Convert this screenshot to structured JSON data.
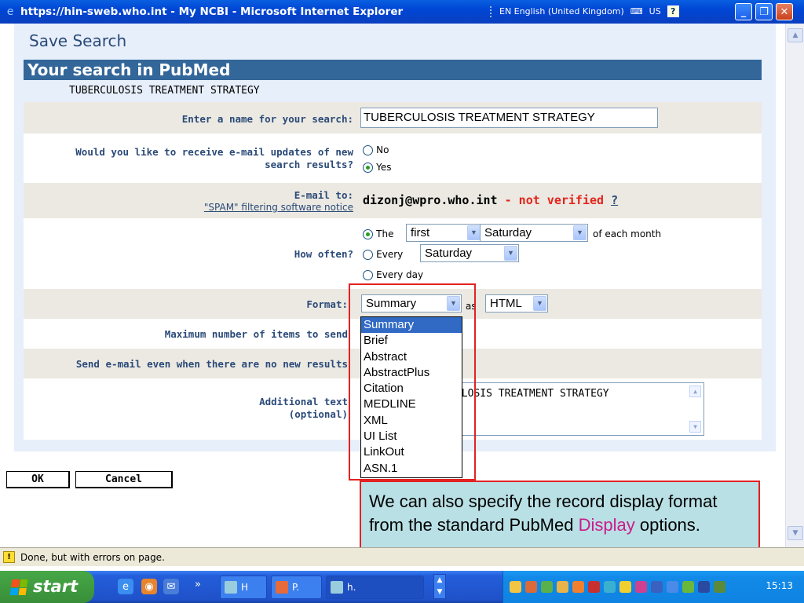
{
  "window": {
    "title": "https://hin-sweb.who.int - My NCBI - Microsoft Internet Explorer",
    "language": "EN English (United Kingdom)",
    "keyboard": "US"
  },
  "page": {
    "heading": "Save Search",
    "section_title": "Your search in PubMed",
    "query": "TUBERCULOSIS TREATMENT STRATEGY",
    "name_label": "Enter a name for your search:",
    "name_value": "TUBERCULOSIS TREATMENT STRATEGY",
    "updates_label_1": "Would you like to receive e-mail updates of new",
    "updates_label_2": "search results?",
    "updates_no": "No",
    "updates_yes": "Yes",
    "email_label": "E-mail to:",
    "spam_link": "\"SPAM\" filtering software notice",
    "email_value": "dizonj@wpro.who.int",
    "not_verified": "- not verified",
    "help_link": "?",
    "how_often_label": "How often?",
    "often_the": "The",
    "often_first": "first",
    "often_day1": "Saturday",
    "often_month": "of each month",
    "often_every": "Every",
    "often_day2": "Saturday",
    "often_everyday": "Every day",
    "format_label": "Format:",
    "format_value": "Summary",
    "as_text": "as",
    "as_value": "HTML",
    "max_label": "Maximum number of items to send",
    "send_label": "Send e-mail even when there are no new results",
    "additional_label": "Additional text",
    "optional_label": "(optional)",
    "additional_value": "TUBERCULOSIS TREATMENT STRATEGY",
    "ok_label": "OK",
    "cancel_label": "Cancel"
  },
  "format_options": [
    "Summary",
    "Brief",
    "Abstract",
    "AbstractPlus",
    "Citation",
    "MEDLINE",
    "XML",
    "UI List",
    "LinkOut",
    "ASN.1"
  ],
  "callout": {
    "text_before": "We can also specify the record display format from the standard PubMed ",
    "highlight": "Display",
    "text_after": " options."
  },
  "status": {
    "text": "Done, but with errors on page."
  },
  "taskbar": {
    "start": "start",
    "task1": "H",
    "task2": "P.",
    "task3": "h.",
    "clock": "15:13"
  },
  "colors": {
    "accent": "#336699",
    "callout_bg": "#b9e0e5",
    "highlight": "#cc1a8a",
    "red": "#e32222"
  }
}
